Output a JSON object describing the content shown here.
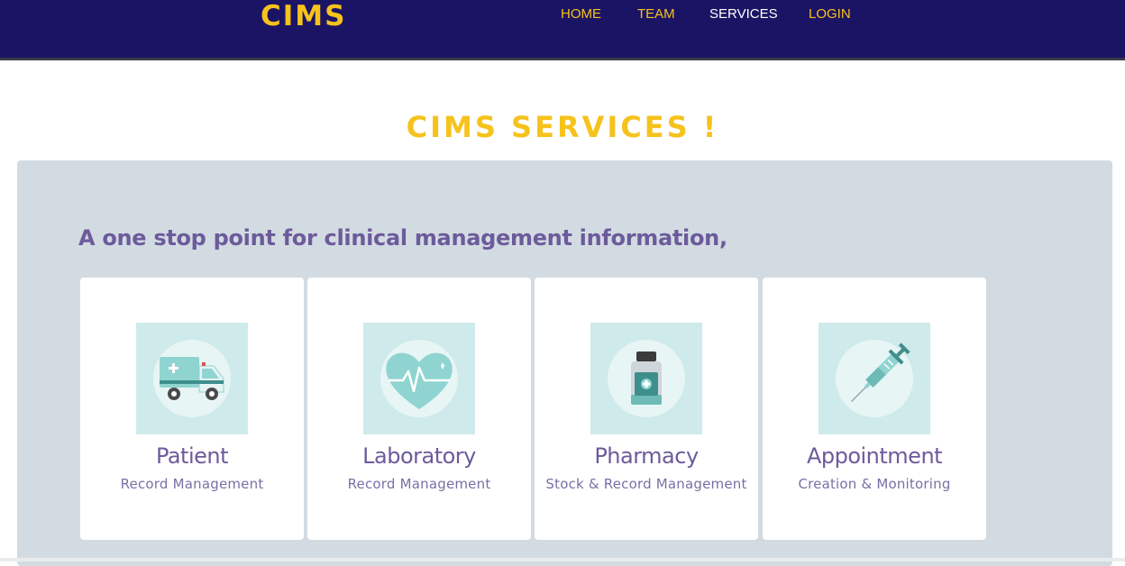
{
  "nav": {
    "brand": "CIMS",
    "links": [
      {
        "label": "HOME",
        "active": false
      },
      {
        "label": "TEAM",
        "active": false
      },
      {
        "label": "SERVICES",
        "active": true
      },
      {
        "label": "LOGIN",
        "active": false
      }
    ]
  },
  "section": {
    "title": "CIMS SERVICES !",
    "tagline": "A one stop point for clinical management information,"
  },
  "services": [
    {
      "title": "Patient",
      "subtitle": "Record Management",
      "icon": "ambulance-icon"
    },
    {
      "title": "Laboratory",
      "subtitle": "Record Management",
      "icon": "heart-pulse-icon"
    },
    {
      "title": "Pharmacy",
      "subtitle": "Stock & Record Management",
      "icon": "medicine-bottle-icon"
    },
    {
      "title": "Appointment",
      "subtitle": "Creation & Monitoring",
      "icon": "syringe-icon"
    }
  ],
  "colors": {
    "navbar": "#1b1464",
    "accent": "#f6c21c",
    "panel": "#d3dbe2",
    "text_purple": "#6c5b9b",
    "icon_bg": "#cfeaea",
    "icon_teal": "#8fd4d0"
  }
}
